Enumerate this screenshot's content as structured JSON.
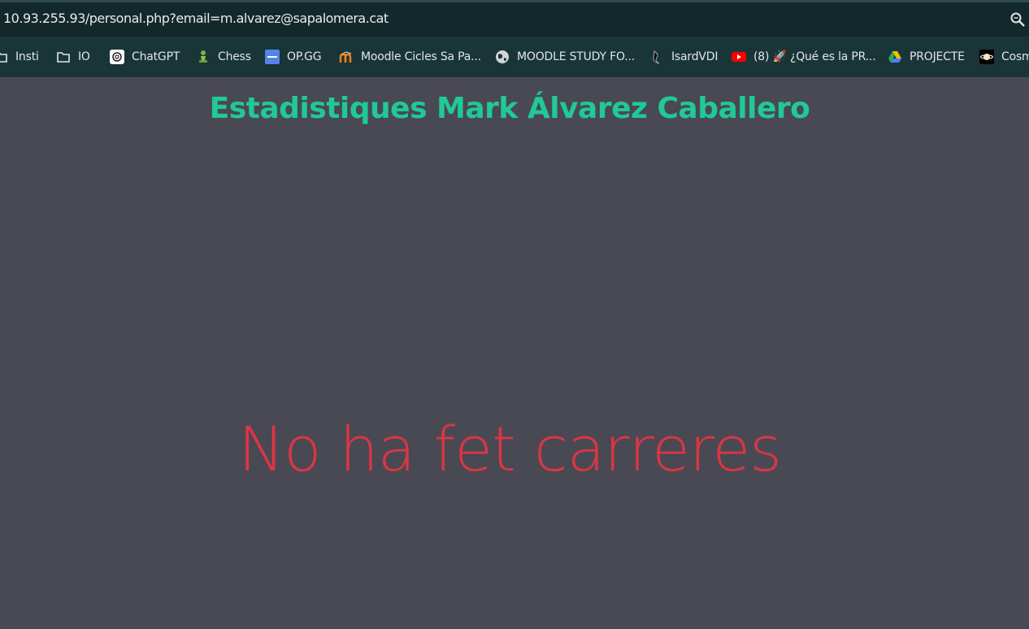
{
  "browser": {
    "url": "10.93.255.93/personal.php?email=m.alvarez@sapalomera.cat",
    "zoom_icon": "zoom-magnifier-icon",
    "bookmarks": [
      {
        "label": "Insti",
        "icon": "folder-icon"
      },
      {
        "label": "IO",
        "icon": "folder-icon"
      },
      {
        "label": "ChatGPT",
        "icon": "chatgpt-icon"
      },
      {
        "label": "Chess",
        "icon": "chess-pawn-icon"
      },
      {
        "label": "OP.GG",
        "icon": "opgg-icon"
      },
      {
        "label": "Moodle Cicles Sa Pa...",
        "icon": "moodle-icon"
      },
      {
        "label": "MOODLE STUDY FO...",
        "icon": "globe-icon"
      },
      {
        "label": "IsardVDI",
        "icon": "isard-icon"
      },
      {
        "label": "(8) 🚀 ¿Qué es la PR...",
        "icon": "youtube-icon"
      },
      {
        "label": "PROJECTE",
        "icon": "google-drive-icon"
      },
      {
        "label": "Cosm",
        "icon": "planet-icon"
      }
    ]
  },
  "page": {
    "title": "Estadistiques Mark Álvarez Caballero",
    "message": "No ha fet carreres"
  },
  "colors": {
    "background": "#494953",
    "title": "#20c997",
    "message": "#dc3545",
    "address_bar": "#13282b",
    "bookmarks_bar": "#1a3538"
  }
}
